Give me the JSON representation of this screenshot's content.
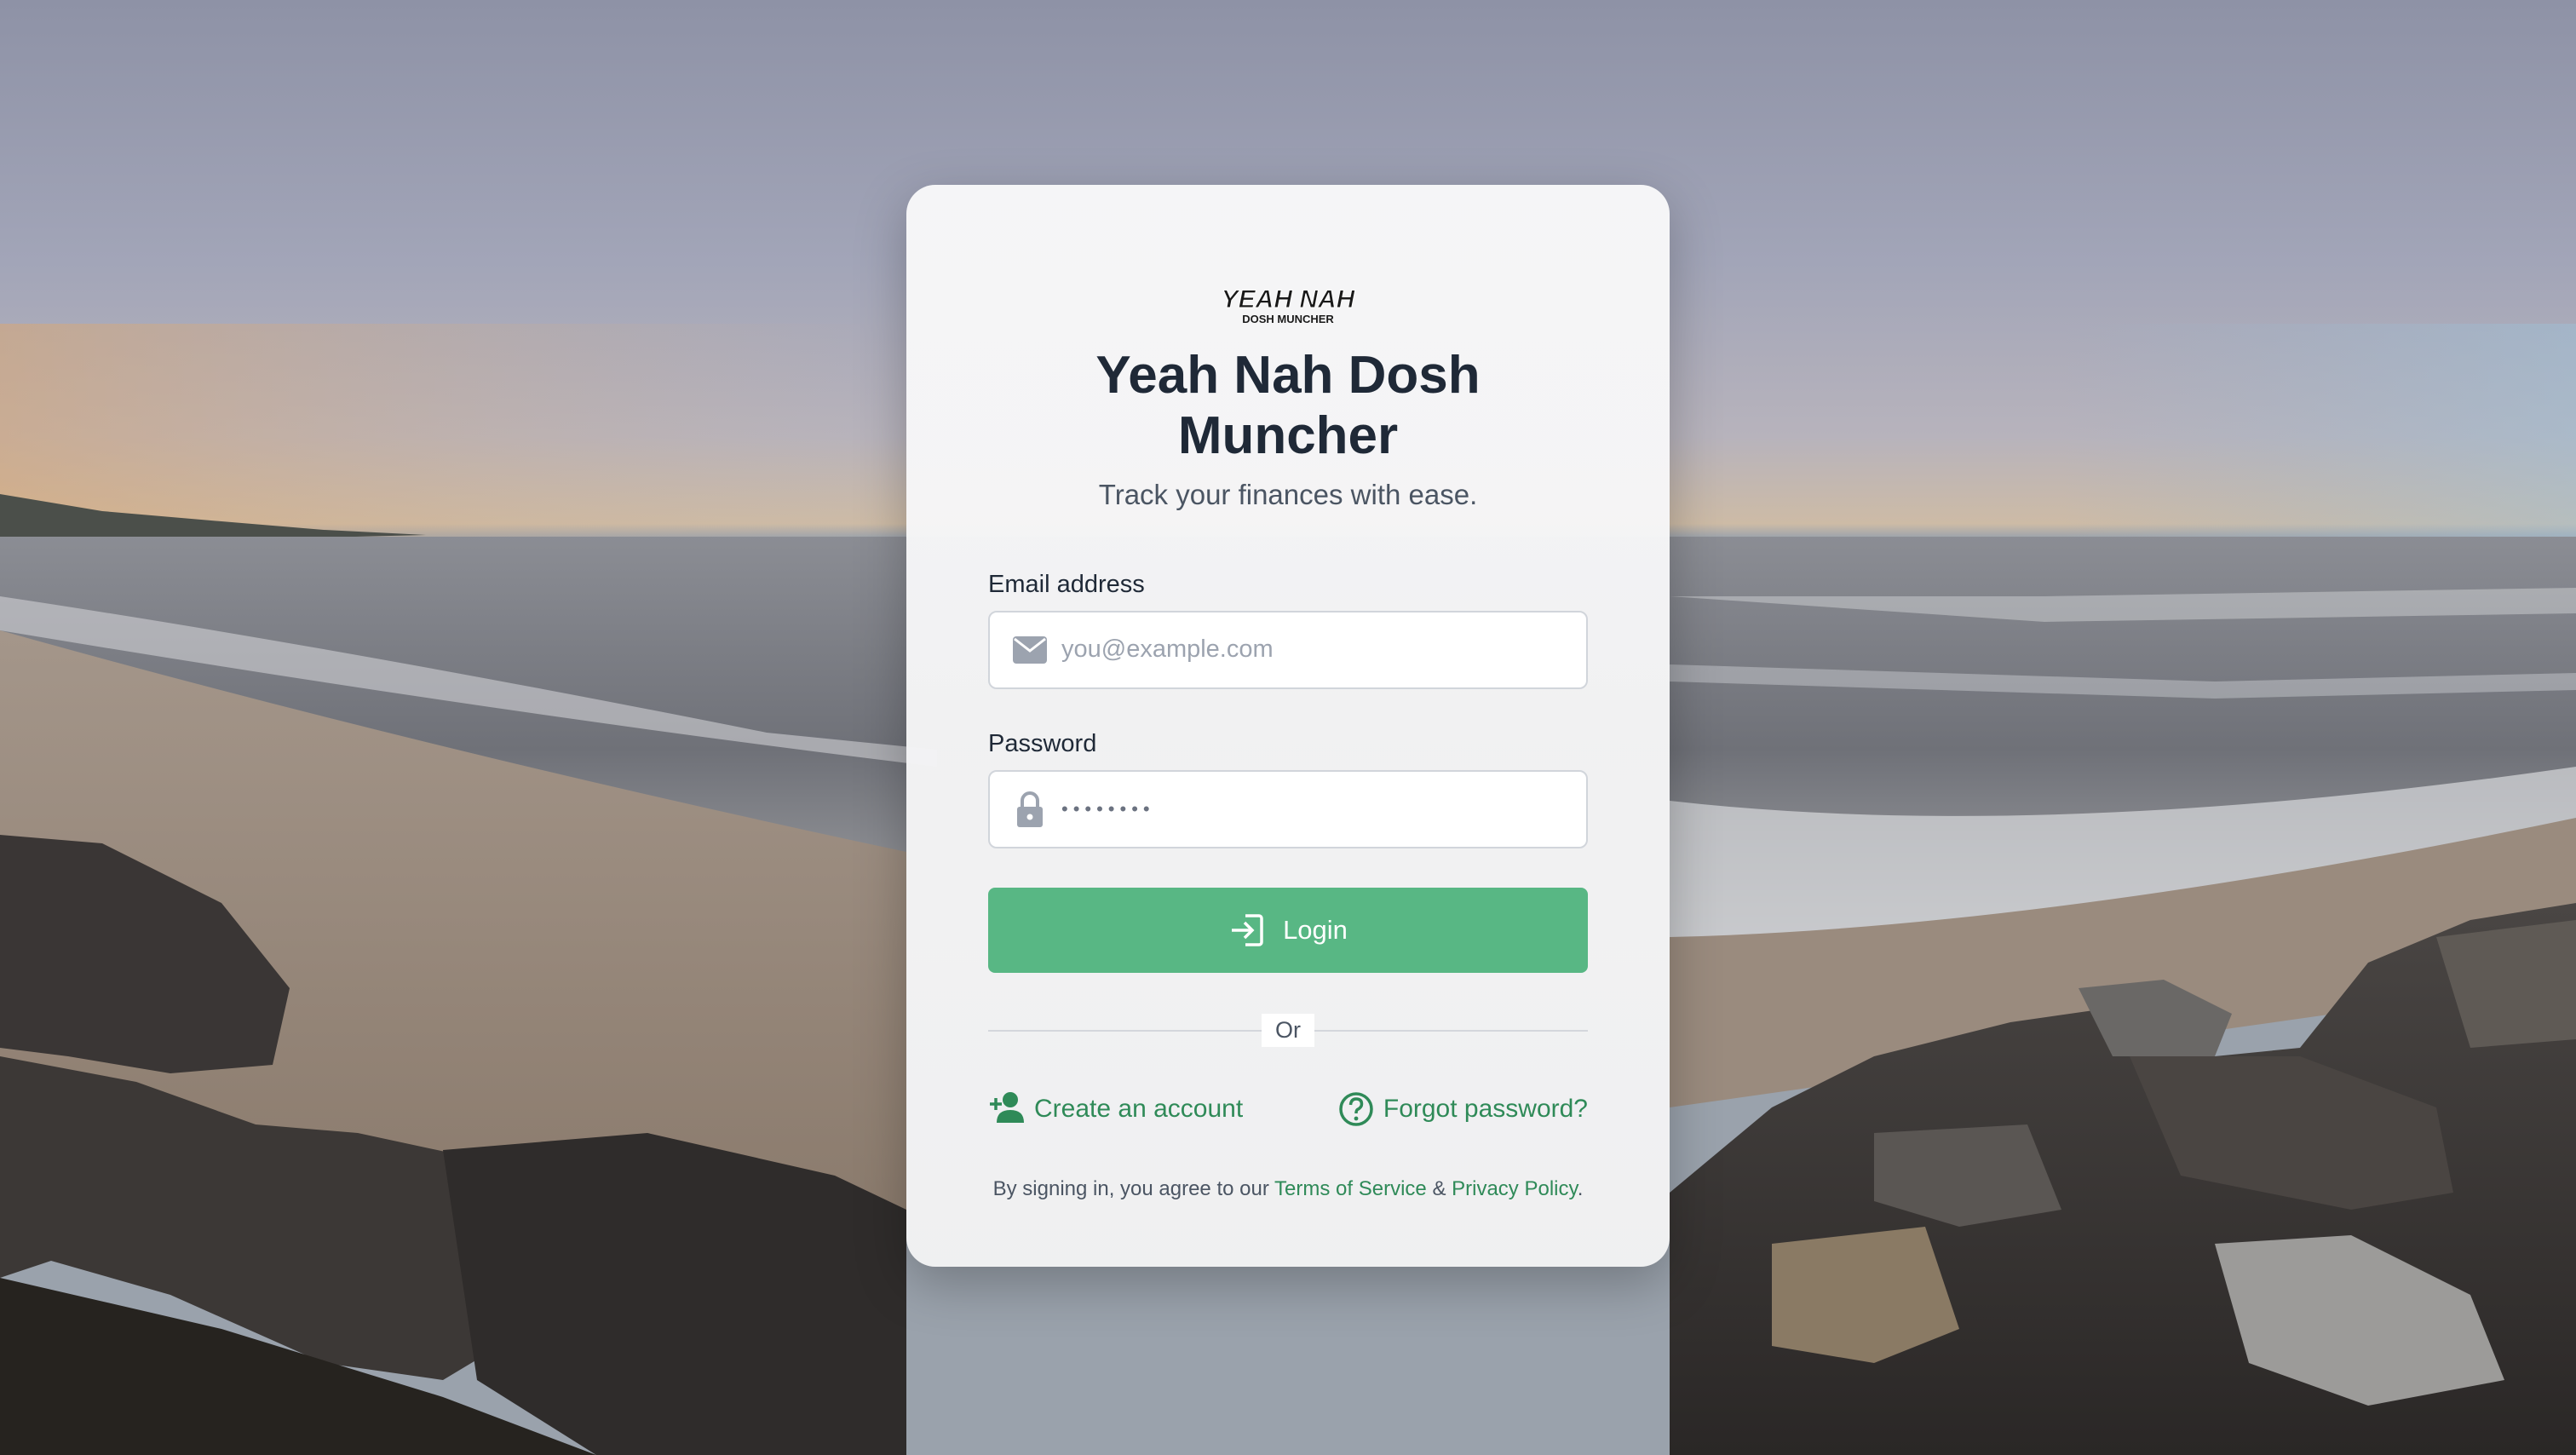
{
  "app": {
    "title": "Yeah Nah Dosh Muncher",
    "subtitle": "Track your finances with ease.",
    "logo_text": "YEAH NAH DOSH MUNCHER"
  },
  "form": {
    "email": {
      "label": "Email address",
      "placeholder": "you@example.com",
      "icon": "envelope-icon"
    },
    "password": {
      "label": "Password",
      "masked_value": "••••••••",
      "icon": "lock-icon"
    },
    "login_button": {
      "label": "Login",
      "icon": "login-icon"
    }
  },
  "divider": {
    "label": "Or"
  },
  "links": {
    "create_account": {
      "label": "Create an account",
      "icon": "add-user-icon"
    },
    "forgot_password": {
      "label": "Forgot password?",
      "icon": "question-circle-icon"
    }
  },
  "terms": {
    "prefix": "By signing in, you agree to our",
    "terms_link": "Terms of Service",
    "joiner": "&",
    "privacy_link": "Privacy Policy",
    "suffix": "."
  },
  "colors": {
    "accent": "#58b784",
    "link": "#2f8a58",
    "title": "#1f2937"
  }
}
